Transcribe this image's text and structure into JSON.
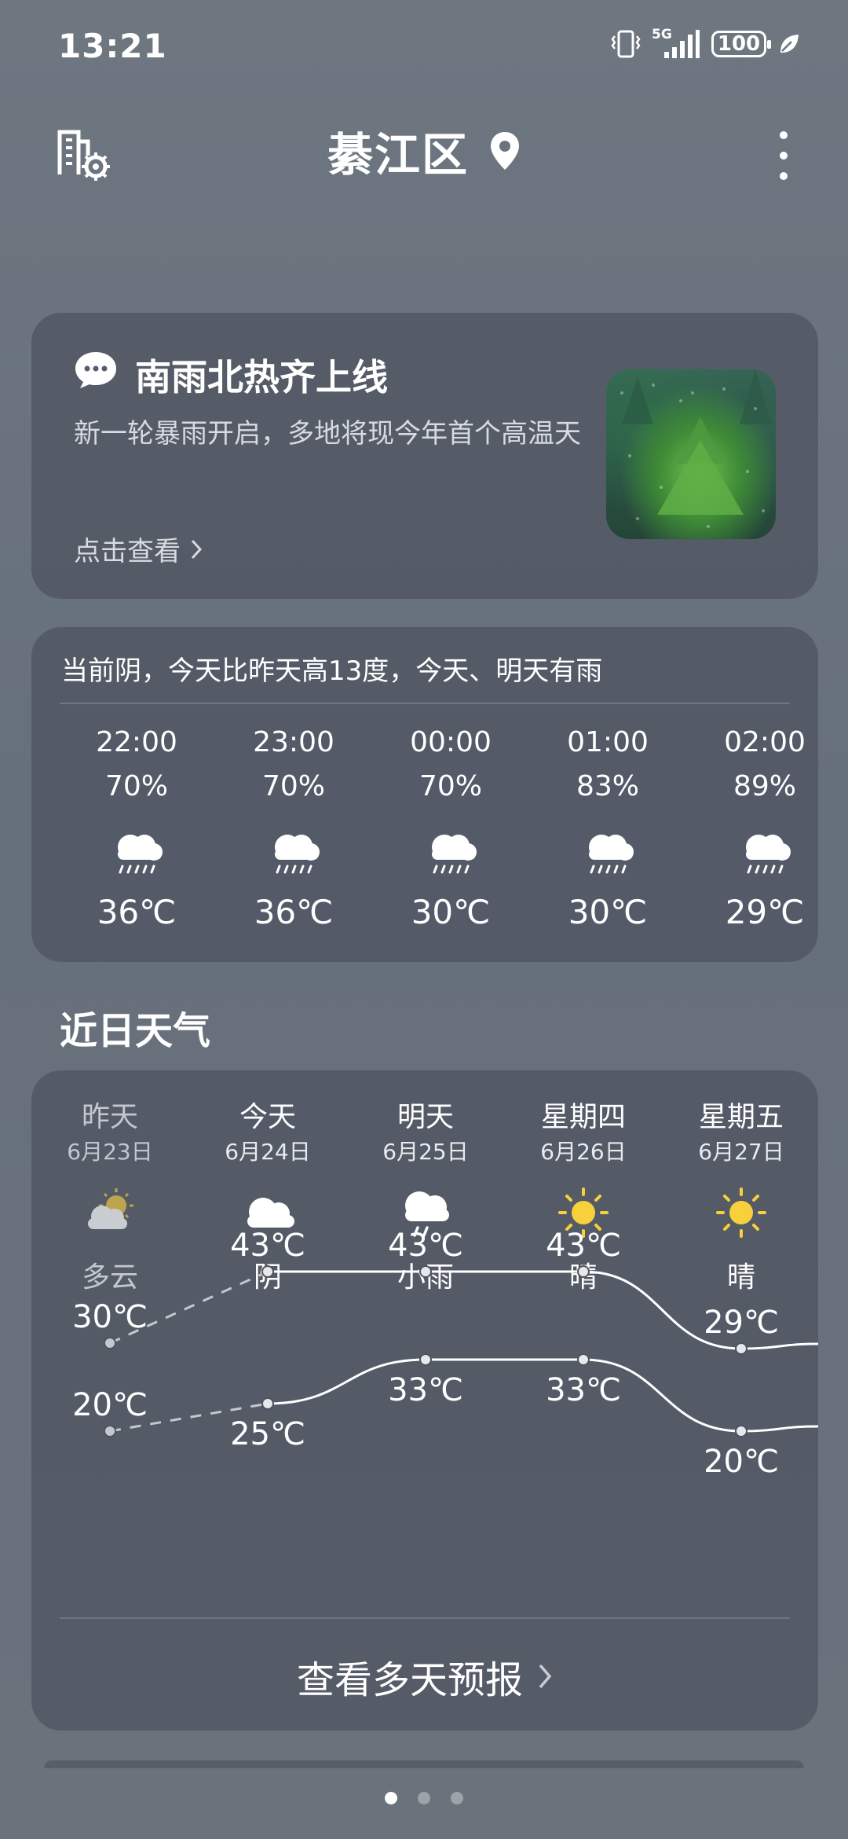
{
  "status_bar": {
    "time": "13:21",
    "network": "5G",
    "battery": "100",
    "icons": [
      "vibrate-icon",
      "signal-5g-icon",
      "battery-icon",
      "leaf-icon"
    ]
  },
  "header": {
    "city": "綦江区",
    "icons": [
      "city-manage-icon",
      "location-pin-icon",
      "more-menu-icon"
    ]
  },
  "news": {
    "title": "南雨北热齐上线",
    "description": "新一轮暴雨开启，多地将现今年首个高温天",
    "link": "点击查看",
    "icon": "message-icon"
  },
  "hourly": {
    "summary": "当前阴，今天比昨天高13度，今天、明天有雨",
    "items": [
      {
        "time": "22:00",
        "pop": "70%",
        "icon": "rain-icon",
        "temp": "36℃"
      },
      {
        "time": "23:00",
        "pop": "70%",
        "icon": "rain-icon",
        "temp": "36℃"
      },
      {
        "time": "00:00",
        "pop": "70%",
        "icon": "rain-icon",
        "temp": "30℃"
      },
      {
        "time": "01:00",
        "pop": "83%",
        "icon": "rain-icon",
        "temp": "30℃"
      },
      {
        "time": "02:00",
        "pop": "89%",
        "icon": "rain-icon",
        "temp": "29℃"
      }
    ]
  },
  "daily": {
    "section_title": "近日天气",
    "more_label": "查看多天预报",
    "days": [
      {
        "name": "昨天",
        "date": "6月23日",
        "icon": "partly-cloudy-icon",
        "cond": "多云",
        "high": "30℃",
        "low": "20℃"
      },
      {
        "name": "今天",
        "date": "6月24日",
        "icon": "cloudy-icon",
        "cond": "阴",
        "high": "43℃",
        "low": "25℃"
      },
      {
        "name": "明天",
        "date": "6月25日",
        "icon": "light-rain-icon",
        "cond": "小雨",
        "high": "43℃",
        "low": "33℃"
      },
      {
        "name": "星期四",
        "date": "6月26日",
        "icon": "sunny-icon",
        "cond": "晴",
        "high": "43℃",
        "low": "33℃"
      },
      {
        "name": "星期五",
        "date": "6月27日",
        "icon": "sunny-icon",
        "cond": "晴",
        "high": "29℃",
        "low": "20℃"
      }
    ]
  },
  "pagination": {
    "count": 3,
    "active": 0
  }
}
